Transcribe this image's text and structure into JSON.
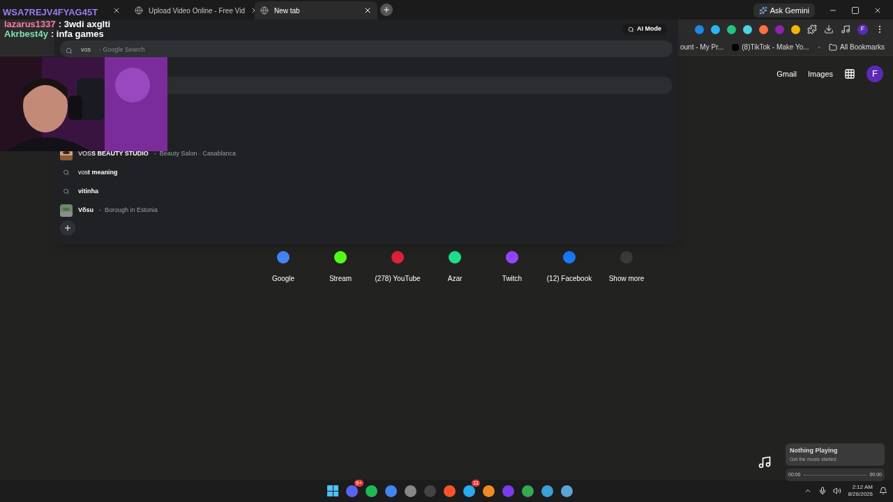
{
  "tabs": [
    {
      "selected": false
    },
    {
      "title": "Upload Video Online - Free Vid",
      "selected": false
    },
    {
      "title": "New tab",
      "selected": true
    }
  ],
  "ask_gemini": "Ask Gemini",
  "toolbar": {
    "profile": "F"
  },
  "bookmarks": [
    {
      "title": "ount - My Pr..."
    },
    {
      "title": "(8)TikTok - Make Yo..."
    }
  ],
  "all_bookmarks": "All Bookmarks",
  "header_links": [
    "Gmail",
    "Images"
  ],
  "account": "F",
  "omnibox": {
    "query": "vos",
    "hint": "- Google Search",
    "ai_mode": "AI Mode",
    "suggestions": [
      {
        "kind": "entity",
        "typed": "VOS",
        "completion": "S BEAUTY STUDIO",
        "detail": "-  Beauty Salon · Casablanca"
      },
      {
        "kind": "search",
        "typed": "vos",
        "completion": "t meaning"
      },
      {
        "kind": "search",
        "completion": "vitinha"
      },
      {
        "kind": "entity",
        "completion": "Võsu",
        "detail": "-  Borough in Estonia"
      }
    ]
  },
  "shortcuts": [
    {
      "label": "Google",
      "color": "#4285f4"
    },
    {
      "label": "Stream",
      "color": "#53fc18"
    },
    {
      "label": "(278) YouTube",
      "color": "#e0213a"
    },
    {
      "label": "Azar",
      "color": "#1ee08c"
    },
    {
      "label": "Twitch",
      "color": "#9146ff"
    },
    {
      "label": "(12) Facebook",
      "color": "#1877f2"
    },
    {
      "label": "Show more",
      "color": "#3a3a3a"
    }
  ],
  "overlay": {
    "code": "WSA7REJV4FYAG45T",
    "chat": [
      {
        "user": "lazarus1337",
        "message": ": 3wdi axglti",
        "color": "#ff7bac"
      },
      {
        "user": "Akrbest4y",
        "message": ": infa games",
        "color": "#7fe3b0"
      }
    ]
  },
  "media": {
    "title": "Nothing Playing",
    "subtitle": "Get the music started",
    "start": "00:00",
    "end": "00:00"
  },
  "taskbar": {
    "apps": [
      {
        "color": "#5865f2",
        "badge": "9+"
      },
      {
        "color": "#1db954"
      },
      {
        "color": "#4285f4"
      },
      {
        "color": "#888888"
      },
      {
        "color": "#444444"
      },
      {
        "color": "#fb542b"
      },
      {
        "color": "#2aabee",
        "badge": "11"
      },
      {
        "color": "#f08a24"
      },
      {
        "color": "#7c3aed"
      },
      {
        "color": "#34a853"
      },
      {
        "color": "#3b9fd8"
      },
      {
        "color": "#5aa5d6"
      }
    ],
    "time": "2:12 AM",
    "date": "8/26/2026"
  }
}
